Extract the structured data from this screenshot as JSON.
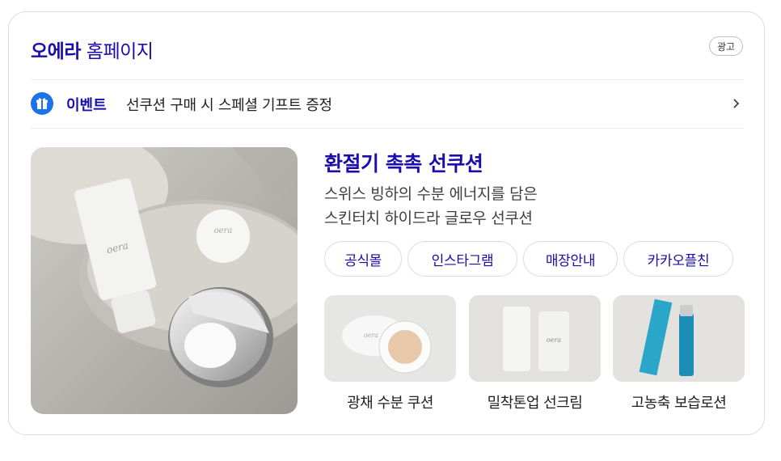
{
  "ad": {
    "brand": "오에라",
    "title_rest": " 홈페이지",
    "badge": "광고"
  },
  "event": {
    "label": "이벤트",
    "text": "선쿠션 구매 시 스페셜 기프트 증정",
    "icon": "gift-icon"
  },
  "hero": {
    "headline": "환절기 촉촉 선쿠션",
    "desc_line1": "스위스 빙하의 수분 에너지를 담은",
    "desc_line2": "스킨터치 하이드라 글로우 선쿠션",
    "image_text": "oera"
  },
  "chips": [
    "공식몰",
    "인스타그램",
    "매장안내",
    "카카오플친"
  ],
  "products": [
    {
      "name": "광채 수분 쿠션"
    },
    {
      "name": "밀착톤업 선크림"
    },
    {
      "name": "고농축 보습로션"
    }
  ],
  "colors": {
    "link": "#1a0dab",
    "accent": "#1a73e8",
    "border": "#dadce0"
  }
}
